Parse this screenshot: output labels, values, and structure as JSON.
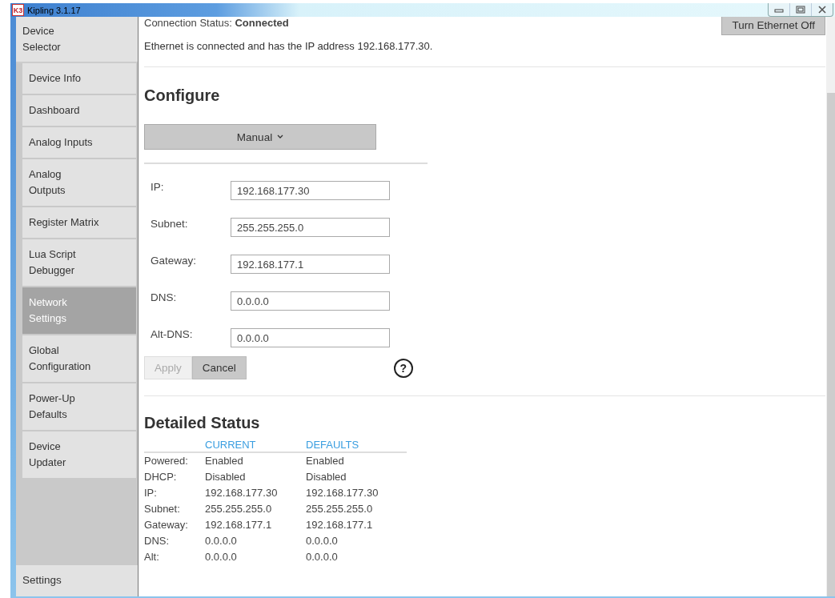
{
  "window": {
    "title": "Kipling 3.1.17",
    "logo": "K3"
  },
  "sidebar": {
    "header": "Device Selector",
    "items": [
      {
        "label": "Device Info",
        "selected": false
      },
      {
        "label": "Dashboard",
        "selected": false
      },
      {
        "label": "Analog Inputs",
        "selected": false
      },
      {
        "label": "Analog Outputs",
        "selected": false
      },
      {
        "label": "Register Matrix",
        "selected": false
      },
      {
        "label": "Lua Script Debugger",
        "selected": false
      },
      {
        "label": "Network Settings",
        "selected": true
      },
      {
        "label": "Global Configuration",
        "selected": false
      },
      {
        "label": "Power-Up Defaults",
        "selected": false
      },
      {
        "label": "Device Updater",
        "selected": false
      }
    ],
    "footer": "Settings"
  },
  "status_line": "Connection Status: **Connected**",
  "turn_off_button": "Turn Ethernet Off",
  "message": "Ethernet is connected and has the IP address 192.168.177.30.",
  "configure": {
    "title": "Configure",
    "mode": "Manual",
    "fields": [
      {
        "label": "IP:",
        "value": "192.168.177.30"
      },
      {
        "label": "Subnet:",
        "value": "255.255.255.0"
      },
      {
        "label": "Gateway:",
        "value": "192.168.177.1"
      },
      {
        "label": "DNS:",
        "value": "0.0.0.0"
      },
      {
        "label": "Alt-DNS:",
        "value": "0.0.0.0"
      }
    ],
    "apply": {
      "label": "Apply",
      "disabled": true
    },
    "cancel": {
      "label": "Cancel",
      "disabled": false
    },
    "help": "?"
  },
  "detailed_status": {
    "title": "Detailed Status",
    "columns": [
      "CURRENT",
      "DEFAULTS"
    ],
    "rows": [
      {
        "label": "Powered:",
        "current": "Enabled",
        "defaults": "Enabled"
      },
      {
        "label": "DHCP:",
        "current": "Disabled",
        "defaults": "Disabled"
      },
      {
        "label": "IP:",
        "current": "192.168.177.30",
        "defaults": "192.168.177.30"
      },
      {
        "label": "Subnet:",
        "current": "255.255.255.0",
        "defaults": "255.255.255.0"
      },
      {
        "label": "Gateway:",
        "current": "192.168.177.1",
        "defaults": "192.168.177.1"
      },
      {
        "label": "DNS:",
        "current": "0.0.0.0",
        "defaults": "0.0.0.0"
      },
      {
        "label": "Alt:",
        "current": "0.0.0.0",
        "defaults": "0.0.0.0"
      }
    ]
  }
}
